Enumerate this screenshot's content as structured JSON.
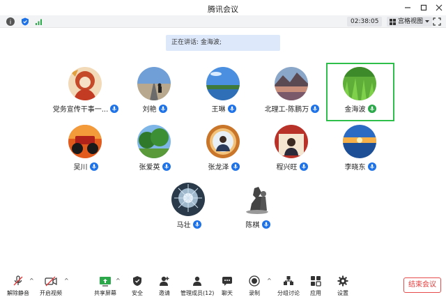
{
  "window": {
    "title": "腾讯会议"
  },
  "strip": {
    "timer": "02:38:05",
    "view_label": "宫格视图"
  },
  "speaking": {
    "text": "正在讲话: 金海波;"
  },
  "participants": [
    {
      "name": "党务宣传干事一...",
      "avatar": "avatar-portrait-red",
      "mic": "blue"
    },
    {
      "name": "刘艳",
      "avatar": "avatar-road",
      "mic": "blue"
    },
    {
      "name": "王琳",
      "avatar": "avatar-lake",
      "mic": "blue"
    },
    {
      "name": "北理工-陈鹏万",
      "avatar": "avatar-mountain-lake",
      "mic": "blue"
    },
    {
      "name": "金海波",
      "avatar": "avatar-grass",
      "mic": "green",
      "active": true
    },
    {
      "name": "吴川",
      "avatar": "avatar-monster-truck",
      "mic": "blue"
    },
    {
      "name": "张爱英",
      "avatar": "avatar-trees",
      "mic": "blue"
    },
    {
      "name": "张龙泽",
      "avatar": "avatar-badge-person",
      "mic": "blue"
    },
    {
      "name": "程兴旺",
      "avatar": "avatar-certificate",
      "mic": "blue"
    },
    {
      "name": "李晓东",
      "avatar": "avatar-sunset",
      "mic": "blue"
    },
    {
      "name": "马壮",
      "avatar": "avatar-splash",
      "mic": "blue"
    },
    {
      "name": "陈棋",
      "avatar": "avatar-chess",
      "mic": "blue"
    }
  ],
  "toolbar": {
    "unmute": "解除静音",
    "start_video": "开启视频",
    "share_screen": "共享屏幕",
    "security": "安全",
    "invite": "邀请",
    "manage_members": "管理成员(12)",
    "chat": "聊天",
    "record": "录制",
    "breakout": "分组讨论",
    "apps": "应用",
    "settings": "设置",
    "end_meeting": "结束会议"
  },
  "colors": {
    "accent": "#1e72e8",
    "active_border": "#2ebf4a",
    "end": "#e43c3c",
    "banner": "#dde9fb"
  }
}
